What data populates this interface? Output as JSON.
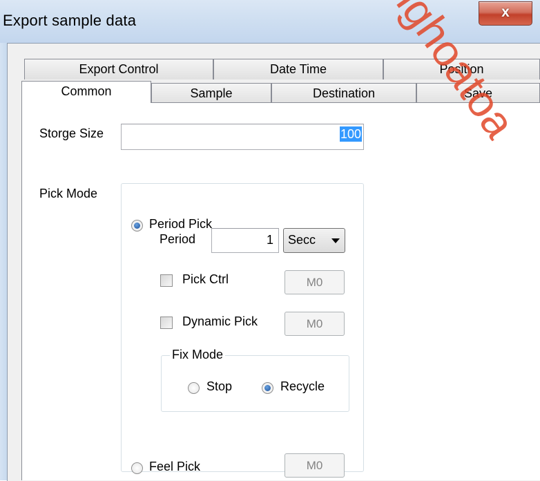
{
  "window": {
    "title": "Export sample data",
    "close_glyph": "x"
  },
  "tabs_back": [
    "Export Control",
    "Date Time",
    "Position"
  ],
  "tabs_front": [
    "Common",
    "Sample",
    "Destination",
    "Save"
  ],
  "active_tab": "Common",
  "storage": {
    "label": "Storge Size",
    "value": "100"
  },
  "pick_mode": {
    "label": "Pick Mode",
    "period_pick": {
      "label": "Period Pick",
      "checked": true
    },
    "period": {
      "label": "Period",
      "value": "1",
      "unit": "Secc"
    },
    "pick_ctrl": {
      "label": "Pick Ctrl",
      "checked": false,
      "address": "M0"
    },
    "dynamic_pick": {
      "label": "Dynamic Pick",
      "checked": false,
      "address": "M0"
    },
    "fix_mode": {
      "label": "Fix Mode",
      "stop": {
        "label": "Stop",
        "checked": false
      },
      "recycle": {
        "label": "Recycle",
        "checked": true
      }
    },
    "feel_pick": {
      "label": "Feel Pick",
      "checked": false,
      "address": "M0"
    }
  },
  "watermark": "nghoatoa",
  "colors": {
    "title_bar": "#cfdff1",
    "close_button": "#c2412b",
    "selection": "#3399ff",
    "watermark": "#e14628"
  }
}
